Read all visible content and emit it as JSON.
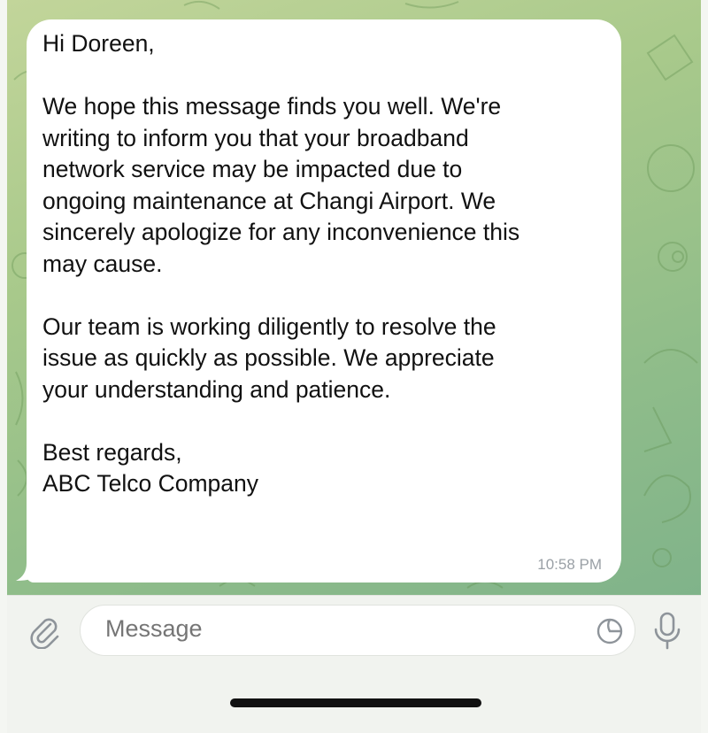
{
  "message": {
    "paragraphs": [
      [
        "Hi Doreen,"
      ],
      [
        "We hope this message finds you well. We're",
        "writing to inform you that your broadband",
        "network service may be impacted due to",
        "ongoing maintenance at Changi Airport. We",
        "sincerely apologize for any inconvenience this",
        "may cause."
      ],
      [
        "Our team is working diligently to resolve the",
        "issue as quickly as possible. We appreciate",
        "your understanding and patience."
      ],
      [
        "Best regards,",
        "ABC Telco Company"
      ]
    ],
    "time": "10:58 PM"
  },
  "composer": {
    "placeholder": "Message"
  },
  "icons": {
    "attach": "paperclip-icon",
    "sticker": "sticker-icon",
    "mic": "microphone-icon"
  },
  "colors": {
    "chat_bg": "#a8c98b",
    "bubble": "#ffffff",
    "time": "#9aa0a6"
  }
}
